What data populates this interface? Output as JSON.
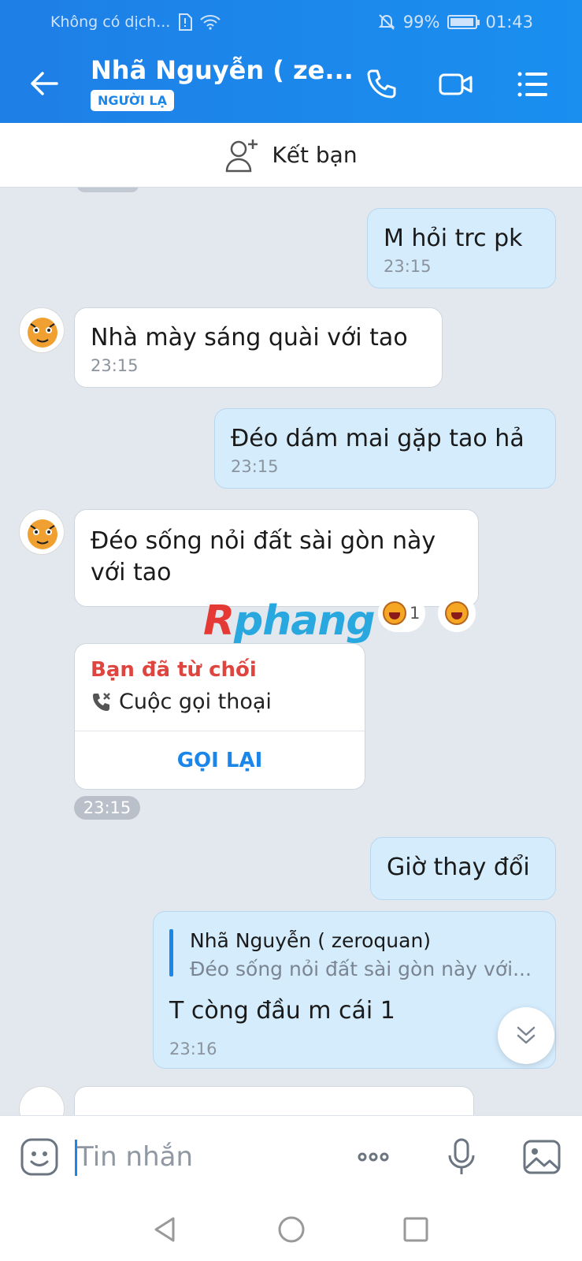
{
  "status": {
    "carrier": "Không có dịch...",
    "battery": "99%",
    "time": "01:43"
  },
  "header": {
    "title": "Nhã Nguyễn ( ze...",
    "badge": "NGƯỜI LẠ"
  },
  "add_friend": {
    "label": "Kết bạn"
  },
  "messages": [
    {
      "text": "M hỏi trc pk",
      "time": "23:15"
    },
    {
      "text": "Nhà mày sáng quài với tao",
      "time": "23:15"
    },
    {
      "text": "Đéo dám mai gặp tao hả",
      "time": "23:15"
    },
    {
      "line1": "Đéo sống nỏi đất sài gòn này",
      "line2": "với tao"
    },
    {
      "text": "Giờ thay đổi"
    }
  ],
  "reaction": {
    "count": "1"
  },
  "watermark": {
    "part1": "R",
    "part2": "phang"
  },
  "call": {
    "status": "Bạn đã từ chối",
    "type": "Cuộc gọi thoại",
    "action": "GỌI LẠI",
    "time": "23:15"
  },
  "reply": {
    "quoted_name": "Nhã Nguyễn ( zeroquan)",
    "quoted_text": "Đéo sống nỏi đất sài gòn này với...",
    "text": "T còng đầu m cái 1",
    "time": "23:16"
  },
  "input": {
    "placeholder": "Tin nhắn"
  },
  "colors": {
    "header": "#1e7fe6",
    "outgoing": "#d5ecfc",
    "accent": "#1b86ea",
    "declined": "#e0443e"
  }
}
